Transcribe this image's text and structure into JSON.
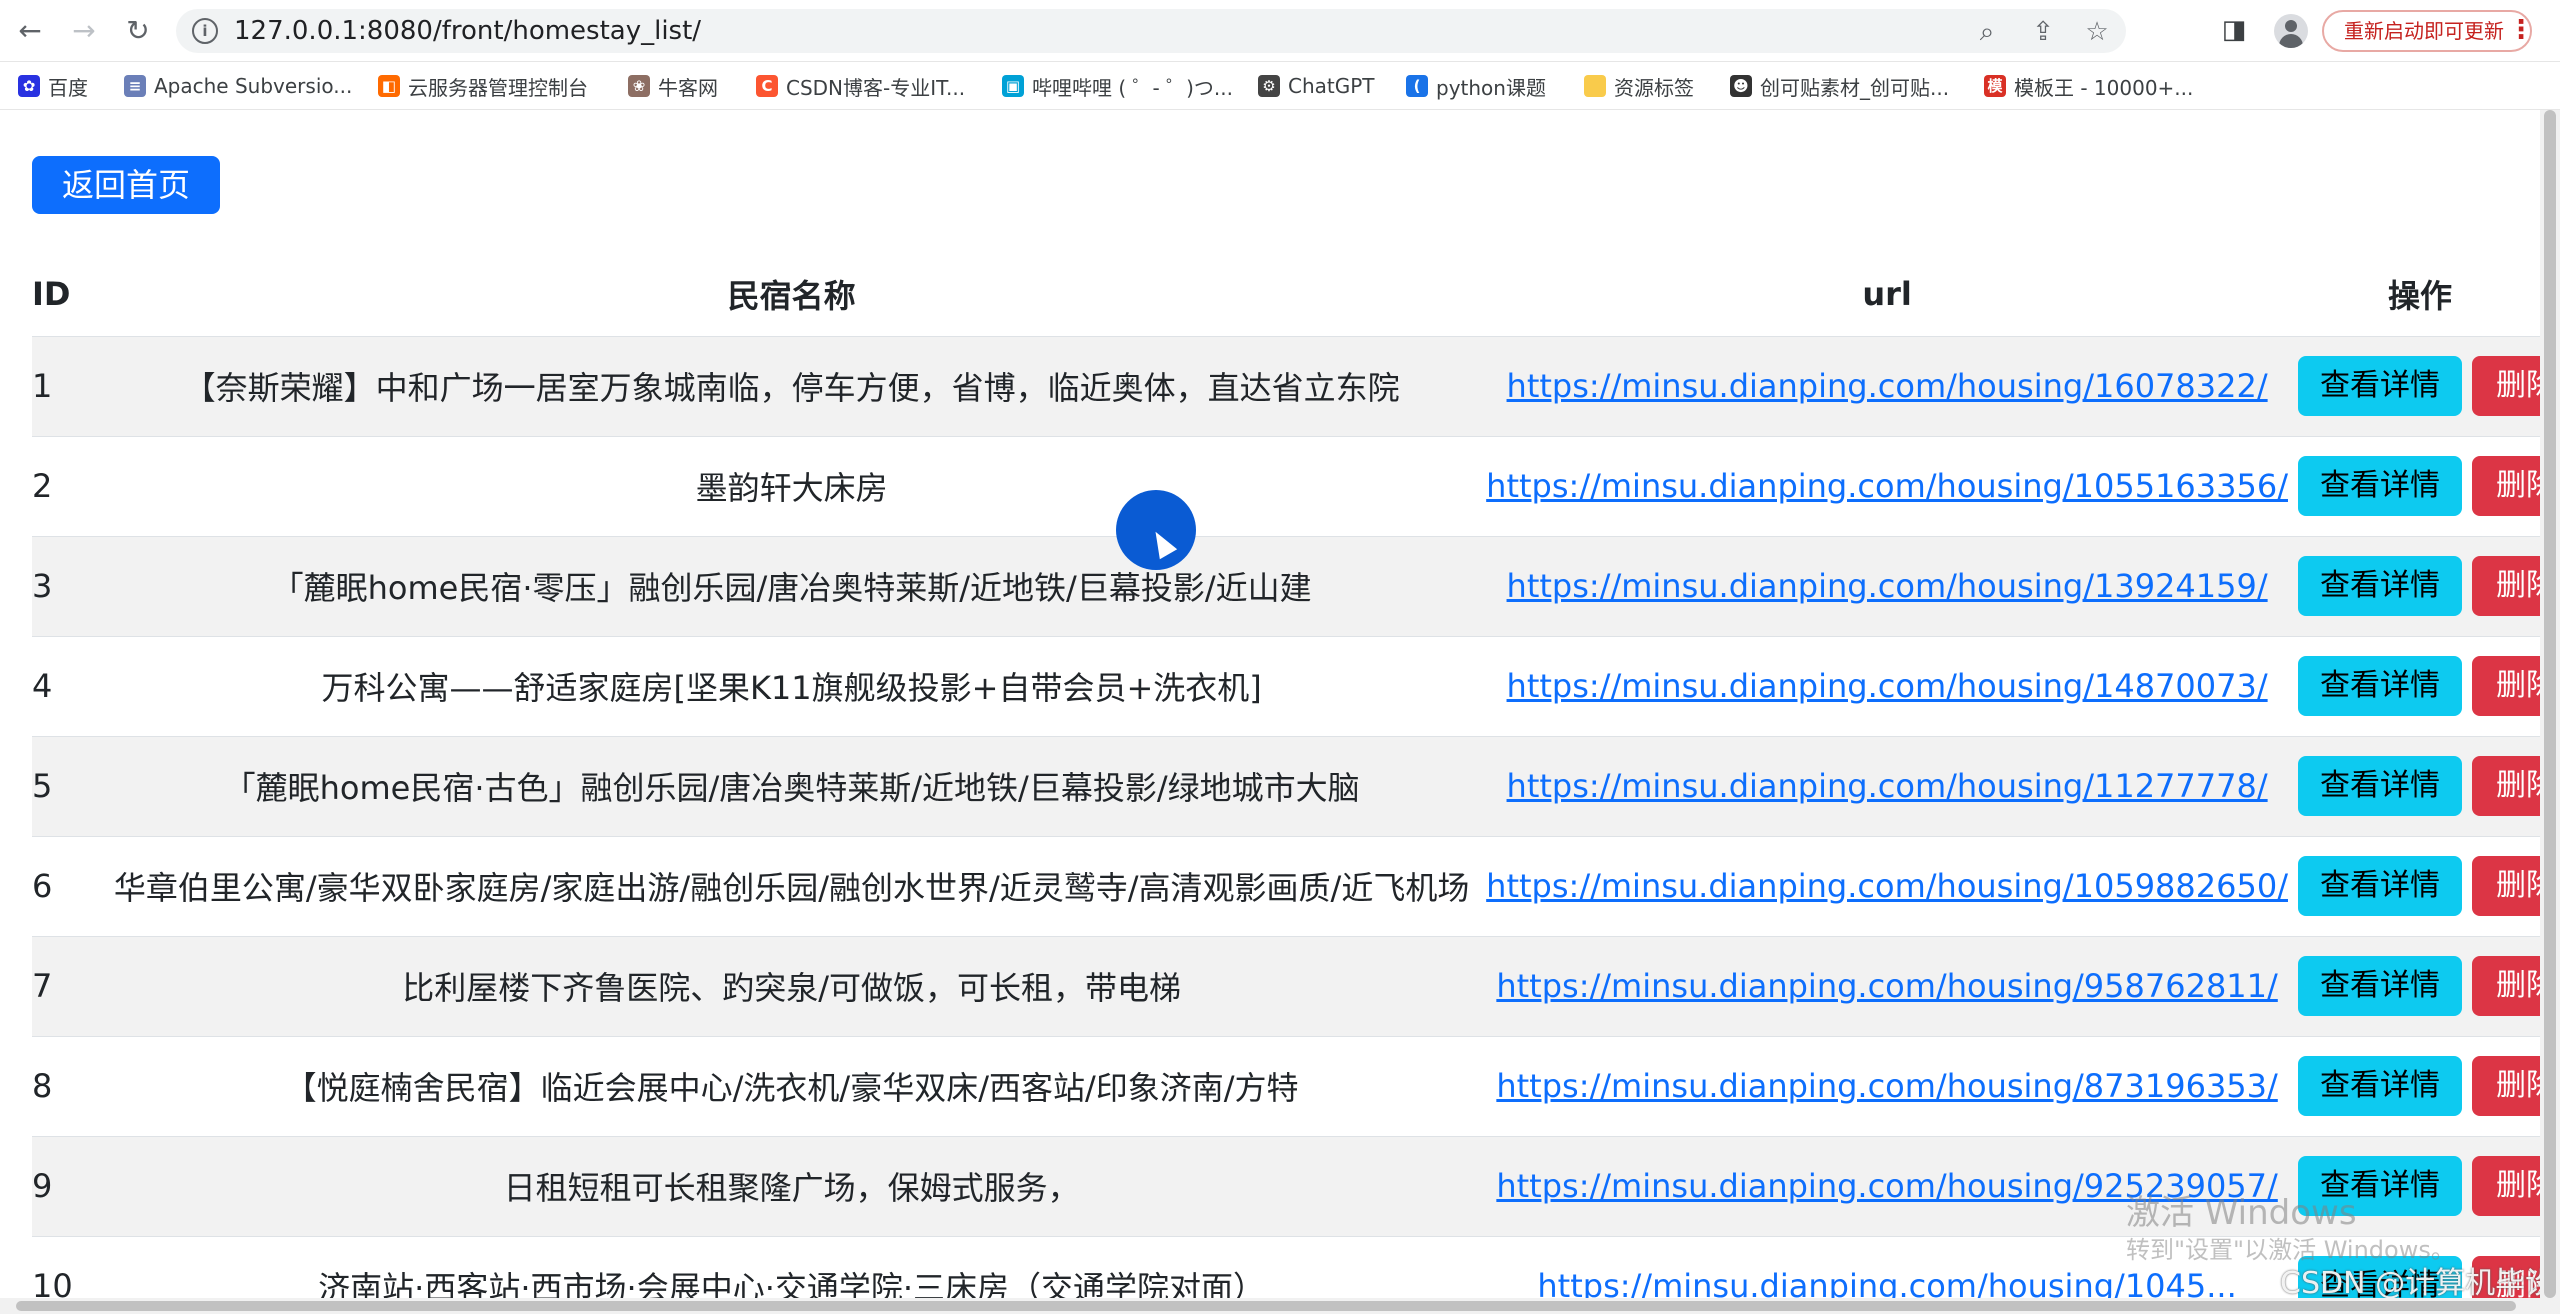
{
  "browser": {
    "url": "127.0.0.1:8080/front/homestay_list/",
    "update_label": "重新启动即可更新",
    "bookmarks": [
      {
        "label": "百度",
        "icon": "baidu-icon",
        "color": "#2932e1",
        "glyph": "✿"
      },
      {
        "label": "Apache Subversio...",
        "icon": "apache-icon",
        "color": "#6b7fb8",
        "glyph": "≡"
      },
      {
        "label": "云服务器管理控制台",
        "icon": "aliyun-icon",
        "color": "#ff6a00",
        "glyph": "◧"
      },
      {
        "label": "牛客网",
        "icon": "nowcoder-icon",
        "color": "#8d6e63",
        "glyph": "❀"
      },
      {
        "label": "CSDN博客-专业IT...",
        "icon": "csdn-icon",
        "color": "#fc5531",
        "glyph": "C"
      },
      {
        "label": "哔哩哔哩 ( ゜- ゜)つ...",
        "icon": "bilibili-icon",
        "color": "#00a1d6",
        "glyph": "▣"
      },
      {
        "label": "ChatGPT",
        "icon": "chatgpt-icon",
        "color": "#444444",
        "glyph": "⚙"
      },
      {
        "label": "python课题",
        "icon": "edge-icon",
        "color": "#1a73e8",
        "glyph": "("
      },
      {
        "label": "资源标签",
        "icon": "folder-icon",
        "color": "#f9cb4b",
        "glyph": ""
      },
      {
        "label": "创可贴素材_创可贴...",
        "icon": "panda-icon",
        "color": "#333333",
        "glyph": "☻"
      },
      {
        "label": "模板王 - 10000+...",
        "icon": "mobanwang-icon",
        "color": "#d93025",
        "glyph": "模"
      }
    ]
  },
  "page": {
    "home_button": "返回首页",
    "headers": {
      "id": "ID",
      "name": "民宿名称",
      "url": "url",
      "op": "操作"
    },
    "detail_label": "查看详情",
    "delete_label": "删除",
    "rows": [
      {
        "id": "1",
        "name": "【奈斯荣耀】中和广场一居室万象城南临，停车方便，省博，临近奥体，直达省立东院",
        "url": "https://minsu.dianping.com/housing/16078322/"
      },
      {
        "id": "2",
        "name": "墨韵轩大床房",
        "url": "https://minsu.dianping.com/housing/1055163356/"
      },
      {
        "id": "3",
        "name": "「麓眠home民宿·零压」融创乐园/唐冶奥特莱斯/近地铁/巨幕投影/近山建",
        "url": "https://minsu.dianping.com/housing/13924159/"
      },
      {
        "id": "4",
        "name": "万科公寓——舒适家庭房[坚果K11旗舰级投影+自带会员+洗衣机]",
        "url": "https://minsu.dianping.com/housing/14870073/"
      },
      {
        "id": "5",
        "name": "「麓眠home民宿·古色」融创乐园/唐冶奥特莱斯/近地铁/巨幕投影/绿地城市大脑",
        "url": "https://minsu.dianping.com/housing/11277778/"
      },
      {
        "id": "6",
        "name": "华章伯里公寓/豪华双卧家庭房/家庭出游/融创乐园/融创水世界/近灵鹫寺/高清观影画质/近飞机场",
        "url": "https://minsu.dianping.com/housing/1059882650/"
      },
      {
        "id": "7",
        "name": "比利屋楼下齐鲁医院、趵突泉/可做饭，可长租，带电梯",
        "url": "https://minsu.dianping.com/housing/958762811/"
      },
      {
        "id": "8",
        "name": "【悦庭楠舍民宿】临近会展中心/洗衣机/豪华双床/西客站/印象济南/方特",
        "url": "https://minsu.dianping.com/housing/873196353/"
      },
      {
        "id": "9",
        "name": "日租短租可长租聚隆广场，保姆式服务，",
        "url": "https://minsu.dianping.com/housing/925239057/"
      },
      {
        "id": "10",
        "name": "济南站·西客站·西市场·会展中心·交通学院·三床房（交通学院对面）",
        "url": "https://minsu.dianping.com/housing/1045..."
      }
    ]
  },
  "overlay": {
    "watermark_title": "激活 Windows",
    "watermark_sub": "转到\"设置\"以激活 Windows。",
    "csdn_watermark": "CSDN @计算机毕设小月哥"
  }
}
